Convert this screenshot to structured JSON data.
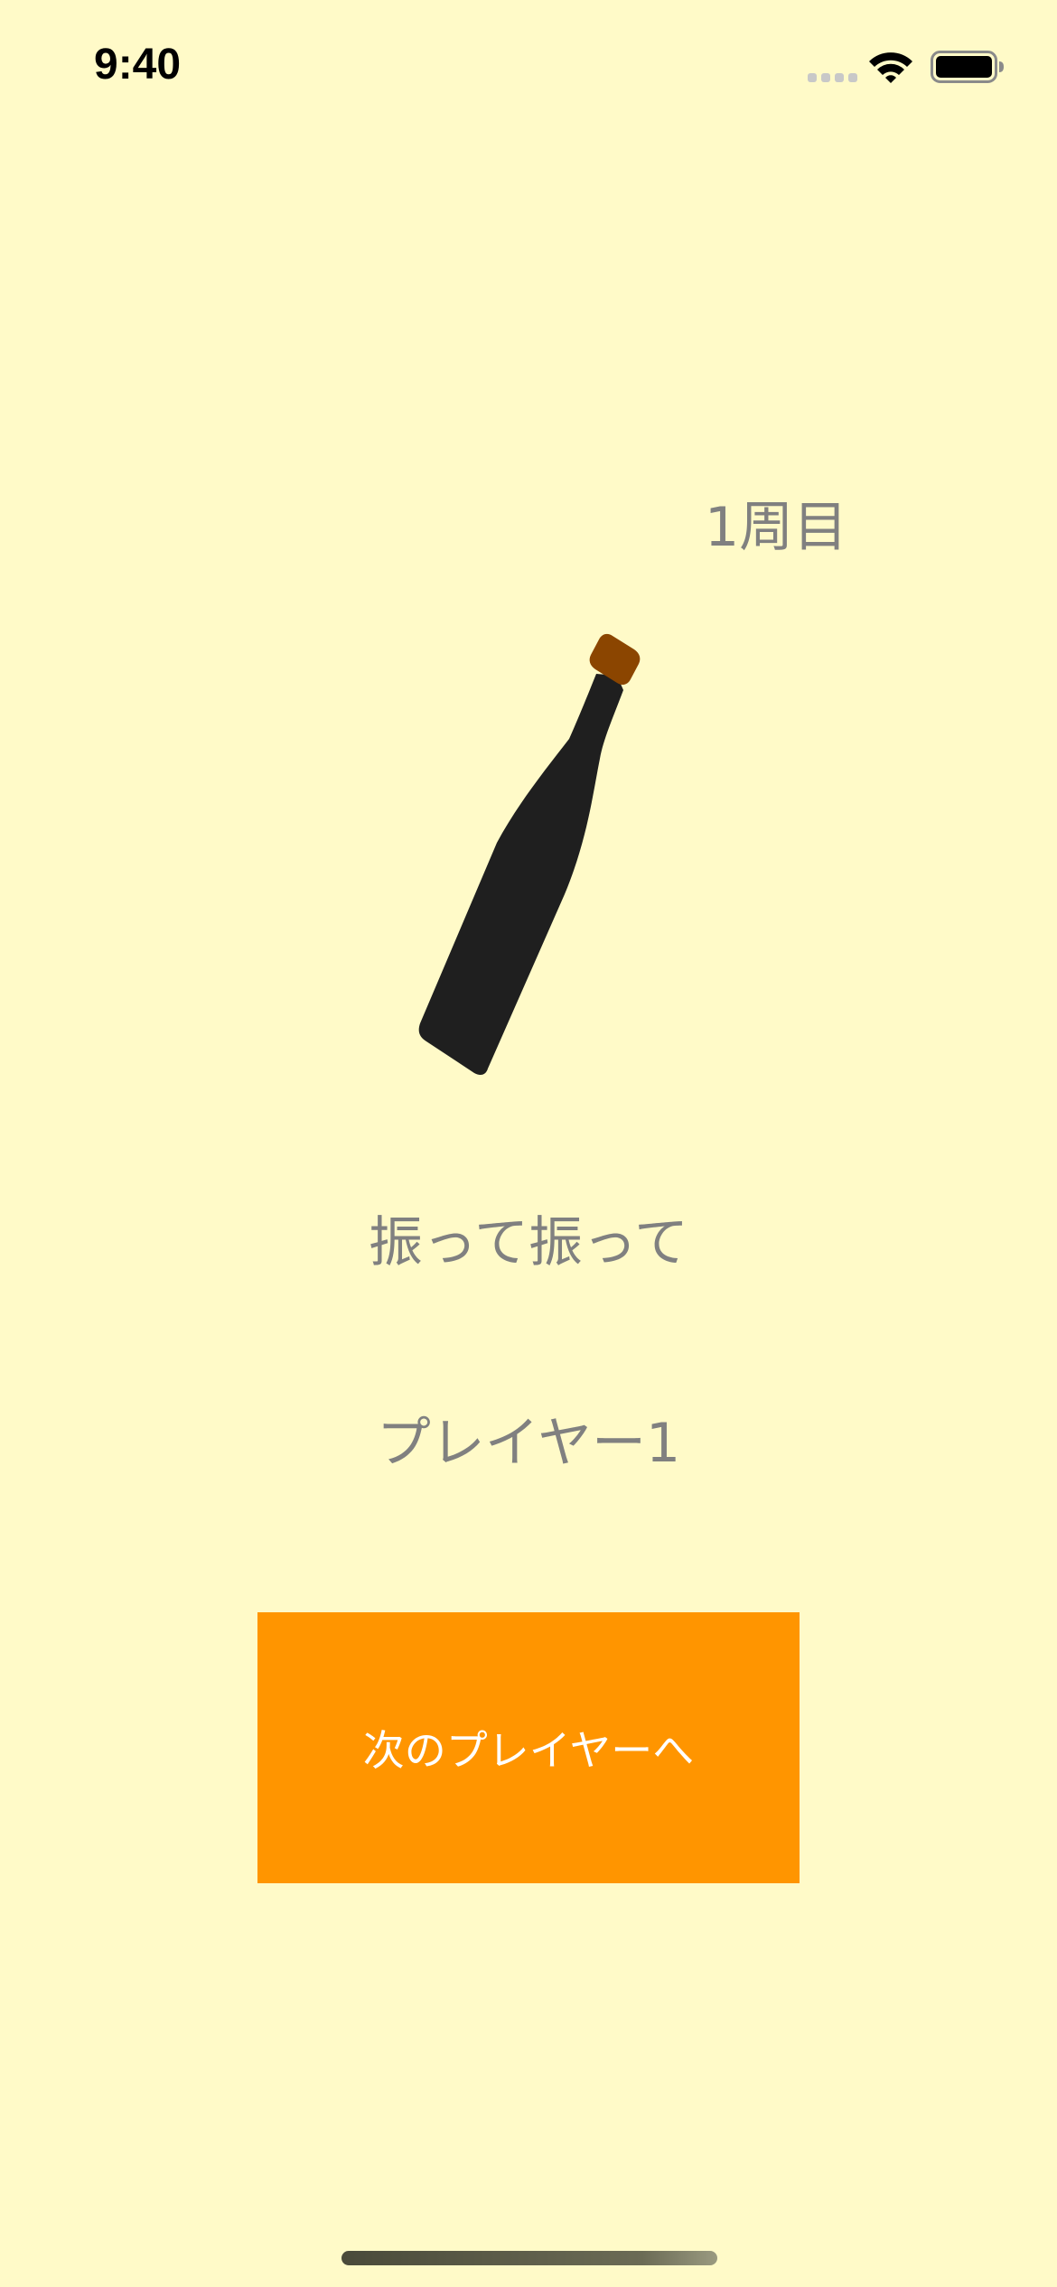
{
  "status_bar": {
    "time": "9:40",
    "icons": [
      "cellular-signal-icon",
      "wifi-icon",
      "battery-icon"
    ]
  },
  "game": {
    "round_label": "1周目",
    "instruction": "振って振って",
    "current_player": "プレイヤー1",
    "next_button_label": "次のプレイヤーへ"
  },
  "colors": {
    "background": "#FFFAC8",
    "button": "#FF9500",
    "bottle": "#1F1F1F",
    "cork": "#8B4500",
    "text_muted": "#808080"
  }
}
